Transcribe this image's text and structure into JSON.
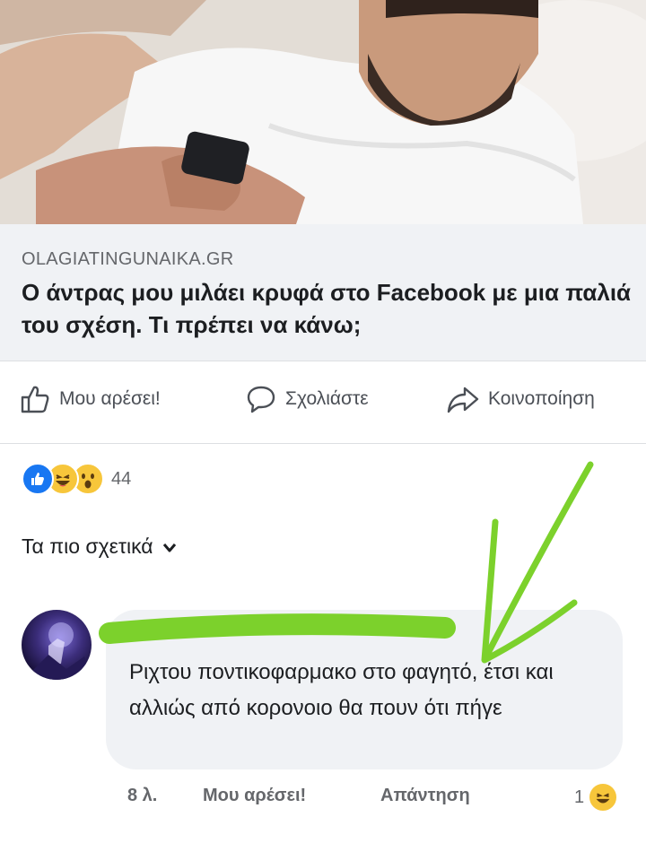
{
  "post": {
    "link_domain": "OLAGIATINGUNAIKA.GR",
    "headline": "Ο άντρας μου μιλάει κρυφά στο Facebook με μια παλιά του σχέση. Τι πρέπει να κάνω;"
  },
  "actions": {
    "like_label": "Μου αρέσει!",
    "comment_label": "Σχολιάστε",
    "share_label": "Κοινοποίηση"
  },
  "reactions": {
    "icons": [
      "like-icon",
      "haha-icon",
      "wow-icon"
    ],
    "count": "44"
  },
  "comments_sort": {
    "label": "Τα πιο σχετικά"
  },
  "comment": {
    "text": "Ριχτου ποντικοφαρμακο στο φαγητό, έτσι και αλλιώς από κορονοιο θα πουν ότι πήγε",
    "time": "8 λ.",
    "like_label": "Μου αρέσει!",
    "reply_label": "Απάντηση",
    "reaction_count": "1",
    "reaction_icon": "haha-icon"
  },
  "colors": {
    "like_blue": "#1877f2",
    "emoji_yellow": "#f7c63b",
    "annotation_green": "#7cd12c",
    "bubble_bg": "#f0f2f5"
  }
}
